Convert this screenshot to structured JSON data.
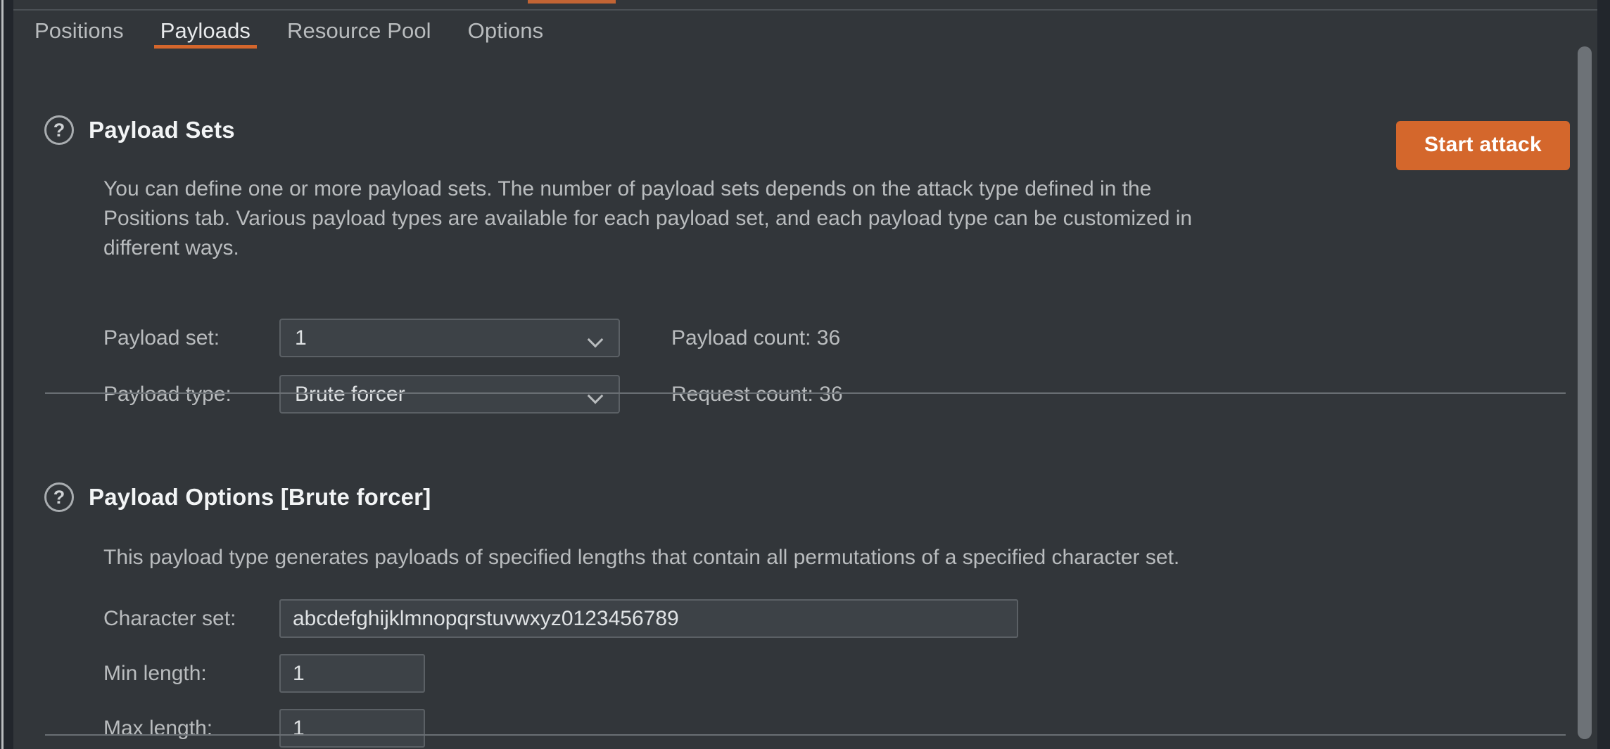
{
  "theme": {
    "accent": "#d4672c",
    "panel_bg": "#32363a",
    "frame_bg": "#22262c",
    "text": "#b9bcbe",
    "heading": "#f2f4f5",
    "field_bg": "#3d4247",
    "field_border": "#5b6065",
    "divider": "#6a6f74"
  },
  "tabs": [
    {
      "label": "Positions",
      "active": false
    },
    {
      "label": "Payloads",
      "active": true
    },
    {
      "label": "Resource Pool",
      "active": false
    },
    {
      "label": "Options",
      "active": false
    }
  ],
  "toolbar": {
    "start_attack_label": "Start attack"
  },
  "payload_sets": {
    "help_icon": "question-mark-circle-icon",
    "title": "Payload Sets",
    "description_lines": [
      "You can define one or more payload sets. The number of payload sets depends on the attack type defined in the",
      "Positions tab. Various payload types are available for each payload set, and each payload type can be customized in",
      "different ways."
    ],
    "payload_set": {
      "label": "Payload set:",
      "value": "1",
      "chevron_icon": "chevron-down-icon"
    },
    "payload_type": {
      "label": "Payload type:",
      "value": "Brute forcer",
      "chevron_icon": "chevron-down-icon"
    },
    "payload_count": "Payload count: 36",
    "request_count": "Request count: 36"
  },
  "payload_options": {
    "help_icon": "question-mark-circle-icon",
    "title": "Payload Options [Brute forcer]",
    "description": "This payload type generates payloads of specified lengths that contain all permutations of a specified character set.",
    "character_set": {
      "label": "Character set:",
      "value": "abcdefghijklmnopqrstuvwxyz0123456789"
    },
    "min_length": {
      "label": "Min length:",
      "value": "1"
    },
    "max_length": {
      "label": "Max length:",
      "value": "1"
    }
  }
}
